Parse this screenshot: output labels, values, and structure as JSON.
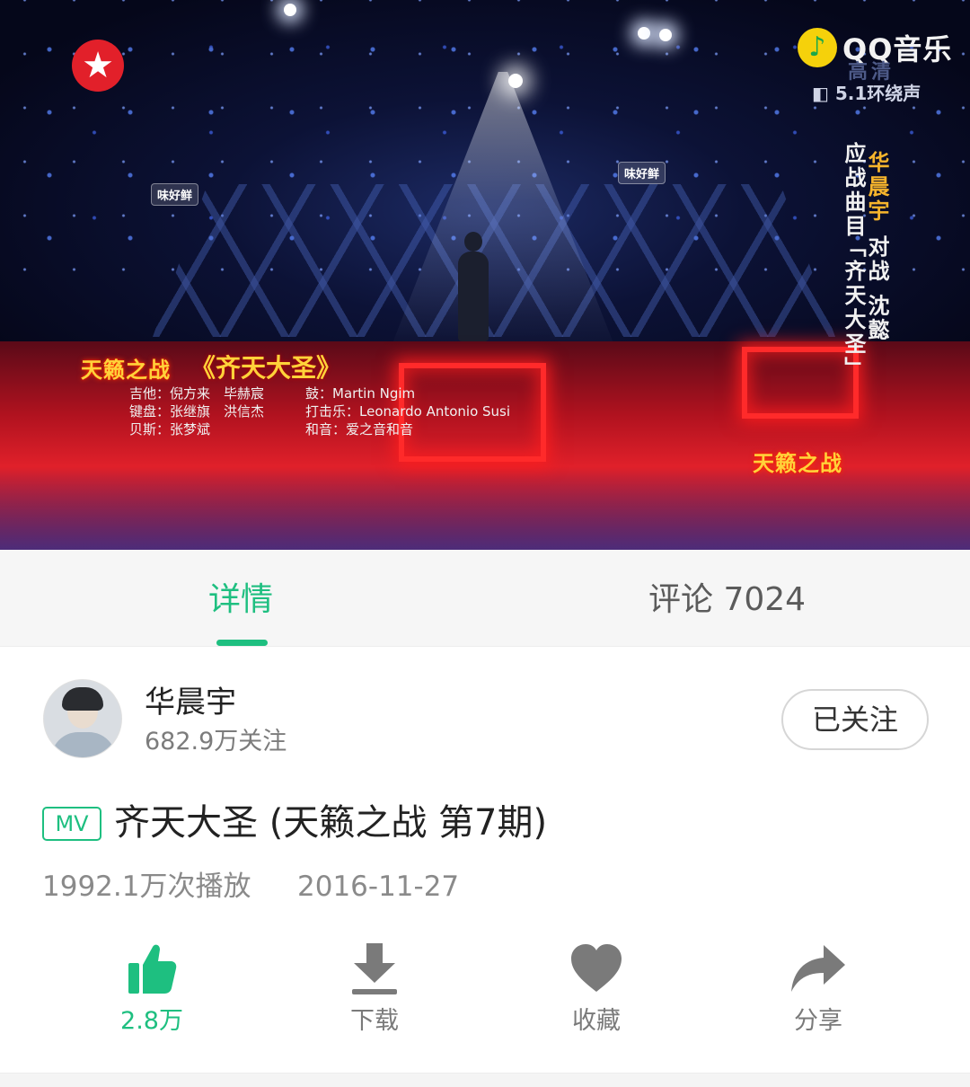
{
  "video": {
    "qq_music_label": "QQ音乐",
    "hd_label": "高清",
    "surround_label": "5.1环绕声",
    "station_logo": "star-logo",
    "right_caption_col1": "华晨宇",
    "right_caption_col2": "对战 沈懿",
    "right_caption_col3": "应战曲目",
    "right_caption_col4": "「齐天大圣」",
    "show_logo_text": "天籁之战",
    "sponsor_text": "味好鲜",
    "song_title": "《齐天大圣》",
    "credits_left": [
      "吉他：倪方来　毕赫宸",
      "键盘：张继旗　洪信杰",
      "贝斯：张梦斌"
    ],
    "credits_right": [
      "鼓：Martin Ngim",
      "打击乐：Leonardo Antonio Susi",
      "和音：爱之音和音"
    ]
  },
  "tabs": {
    "details": "详情",
    "comments": "评论 7024"
  },
  "artist": {
    "name": "华晨宇",
    "followers": "682.9万关注",
    "follow_button": "已关注"
  },
  "mv": {
    "badge": "MV",
    "title": "齐天大圣 (天籁之战 第7期)",
    "plays": "1992.1万次播放",
    "date": "2016-11-27"
  },
  "actions": {
    "like_count": "2.8万",
    "download": "下载",
    "favorite": "收藏",
    "share": "分享"
  },
  "colors": {
    "accent": "#1ebf80",
    "icon_gray": "#7a7a7a"
  }
}
